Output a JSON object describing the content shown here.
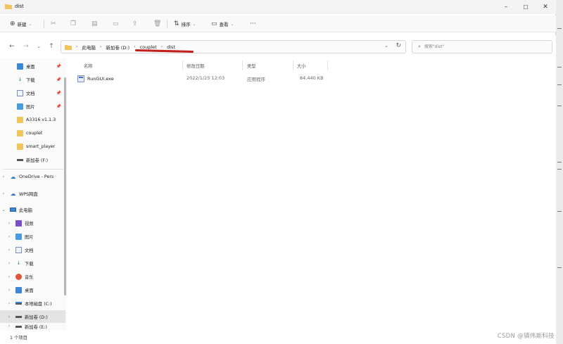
{
  "window": {
    "title": "dist",
    "minimize": "–",
    "maximize": "☐",
    "close": "✕"
  },
  "toolbar": {
    "new_label": "新建",
    "sort_label": "排序",
    "view_label": "查看",
    "more_label": "···"
  },
  "nav": {
    "back": "←",
    "forward": "→",
    "recent": "⌄",
    "up": "↑"
  },
  "address": {
    "crumbs": [
      "此电脑",
      "新加卷 (D:)",
      "couplet",
      "dist"
    ]
  },
  "search": {
    "placeholder": "搜索\"dist\""
  },
  "sidebar": {
    "items": [
      {
        "label": "桌面",
        "pinned": true
      },
      {
        "label": "下载",
        "pinned": true
      },
      {
        "label": "文档",
        "pinned": true
      },
      {
        "label": "图片",
        "pinned": true
      },
      {
        "label": "A3316 v1.1.3"
      },
      {
        "label": "couplet"
      },
      {
        "label": "smart_player"
      },
      {
        "label": "新加卷 (F:)"
      },
      {
        "label": "OneDrive - Pers"
      },
      {
        "label": "WPS网盘"
      },
      {
        "label": "此电脑"
      },
      {
        "label": "视频"
      },
      {
        "label": "图片"
      },
      {
        "label": "文档"
      },
      {
        "label": "下载"
      },
      {
        "label": "音乐"
      },
      {
        "label": "桌面"
      },
      {
        "label": "本地磁盘 (C:)"
      },
      {
        "label": "新加卷 (D:)"
      },
      {
        "label": "新加卷 (E:)"
      }
    ]
  },
  "columns": {
    "name": "名称",
    "modified": "修改日期",
    "type": "类型",
    "size": "大小"
  },
  "files": [
    {
      "name": "RunGUI.exe",
      "modified": "2022/1/25 12:03",
      "type": "应用程序",
      "size": "84,440 KB"
    }
  ],
  "status": {
    "count": "1 个项目"
  },
  "watermark": "CSDN @镇伟斯科技"
}
